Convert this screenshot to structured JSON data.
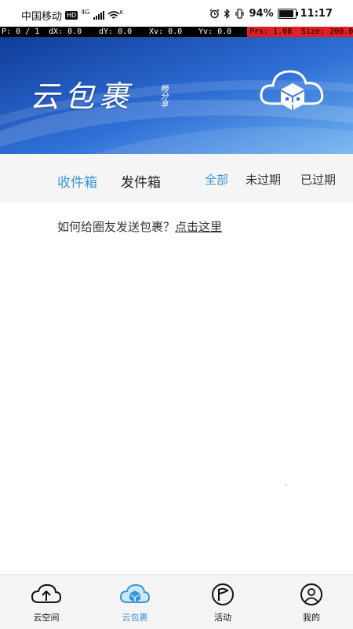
{
  "status_bar": {
    "carrier": "中国移动",
    "hd": "HD",
    "network": "4G",
    "wifi_level": "6",
    "battery_percent": "94%",
    "battery_level": 0.94,
    "time": "11:17"
  },
  "debug_bar": {
    "p": "P: 0 / 1",
    "dx": "dX: 0.0",
    "dy": "dY: 0.0",
    "xv": "Xv: 0.0",
    "yv": "Yv: 0.0",
    "prs": "Prs: 1.08",
    "size": "Size: 200.0"
  },
  "banner": {
    "title": "云包裹",
    "subtitle": "畅分享",
    "colors": {
      "dark": "#103c9a",
      "mid": "#2f6fd6",
      "light": "#6fb2f0"
    }
  },
  "tabs": {
    "inbox": "收件箱",
    "outbox": "发件箱",
    "active": "inbox"
  },
  "filters": {
    "all": "全部",
    "unexpired": "未过期",
    "expired": "已过期",
    "active": "all"
  },
  "hint": {
    "text": "如何给圈友发送包裹？",
    "link": "点击这里"
  },
  "nav": {
    "items": [
      {
        "label": "云空间",
        "icon": "cloud-upload-icon"
      },
      {
        "label": "云包裹",
        "icon": "cloud-package-icon"
      },
      {
        "label": "活动",
        "icon": "flag-icon"
      },
      {
        "label": "我的",
        "icon": "user-icon"
      }
    ],
    "active_index": 1
  },
  "colors": {
    "accent": "#3a95d8",
    "debug_red": "#e02020"
  }
}
